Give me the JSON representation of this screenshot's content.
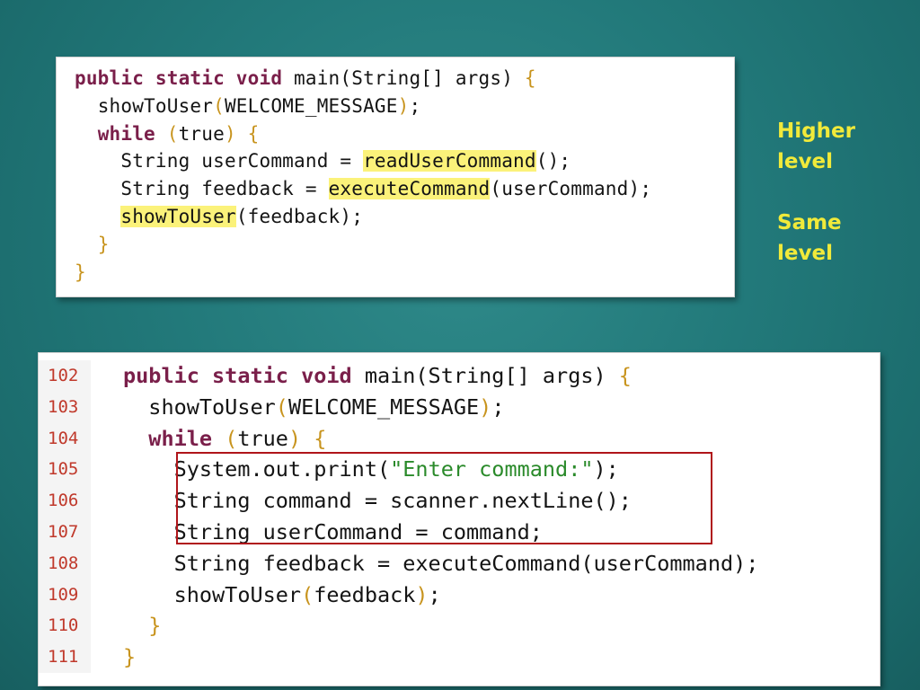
{
  "top_snippet": {
    "line1": {
      "kw": "public static void",
      "rest": " main(String[] args) ",
      "brace": "{"
    },
    "line2": {
      "fn": "showToUser",
      "po": "(",
      "arg": "WELCOME_MESSAGE",
      "pc": ")",
      "end": ";"
    },
    "line3": {
      "kw": "while",
      "po": "(",
      "arg": "true",
      "pc": ")",
      "brace": "{"
    },
    "line4": {
      "pre": "String userCommand = ",
      "hl": "readUserCommand",
      "post": "();"
    },
    "line5": {
      "pre": "String feedback = ",
      "hl": "executeCommand",
      "post": "(userCommand);"
    },
    "line6": {
      "hl": "showToUser",
      "post": "(feedback);"
    },
    "line7": {
      "brace": "}"
    },
    "line8": {
      "brace": "}"
    }
  },
  "side_labels": {
    "higher": "Higher\nlevel",
    "same": "Same\nlevel"
  },
  "bottom_snippet": {
    "line_numbers": [
      "102",
      "103",
      "104",
      "105",
      "106",
      "107",
      "108",
      "109",
      "110",
      "111"
    ],
    "line1": {
      "kw": "public static void",
      "rest": " main(String[] args) ",
      "brace": "{"
    },
    "line2": {
      "fn": "showToUser",
      "po": "(",
      "arg": "WELCOME_MESSAGE",
      "pc": ")",
      "end": ";"
    },
    "line3": {
      "kw": "while",
      "po": "(",
      "arg": "true",
      "pc": ")",
      "brace": "{"
    },
    "line4": {
      "pre": "System.out.print(",
      "str": "\"Enter command:\"",
      "post": ");"
    },
    "line5": {
      "text": "String command = scanner.nextLine();"
    },
    "line6": {
      "text": "String userCommand = command;"
    },
    "line7": {
      "text": "String feedback = executeCommand(userCommand);"
    },
    "line8": {
      "fn": "showToUser",
      "po": "(",
      "arg": "feedback",
      "pc": ")",
      "end": ";"
    },
    "line9": {
      "brace": "}"
    },
    "line10": {
      "brace": "}"
    }
  },
  "colors": {
    "background": "#22797a",
    "keyword": "#7a1f4a",
    "bracket": "#c8941e",
    "string": "#2a8a2a",
    "highlight": "#fbf27a",
    "line_number": "#c0392b",
    "box_border": "#b0151a",
    "side_label": "#f1ea3a"
  }
}
